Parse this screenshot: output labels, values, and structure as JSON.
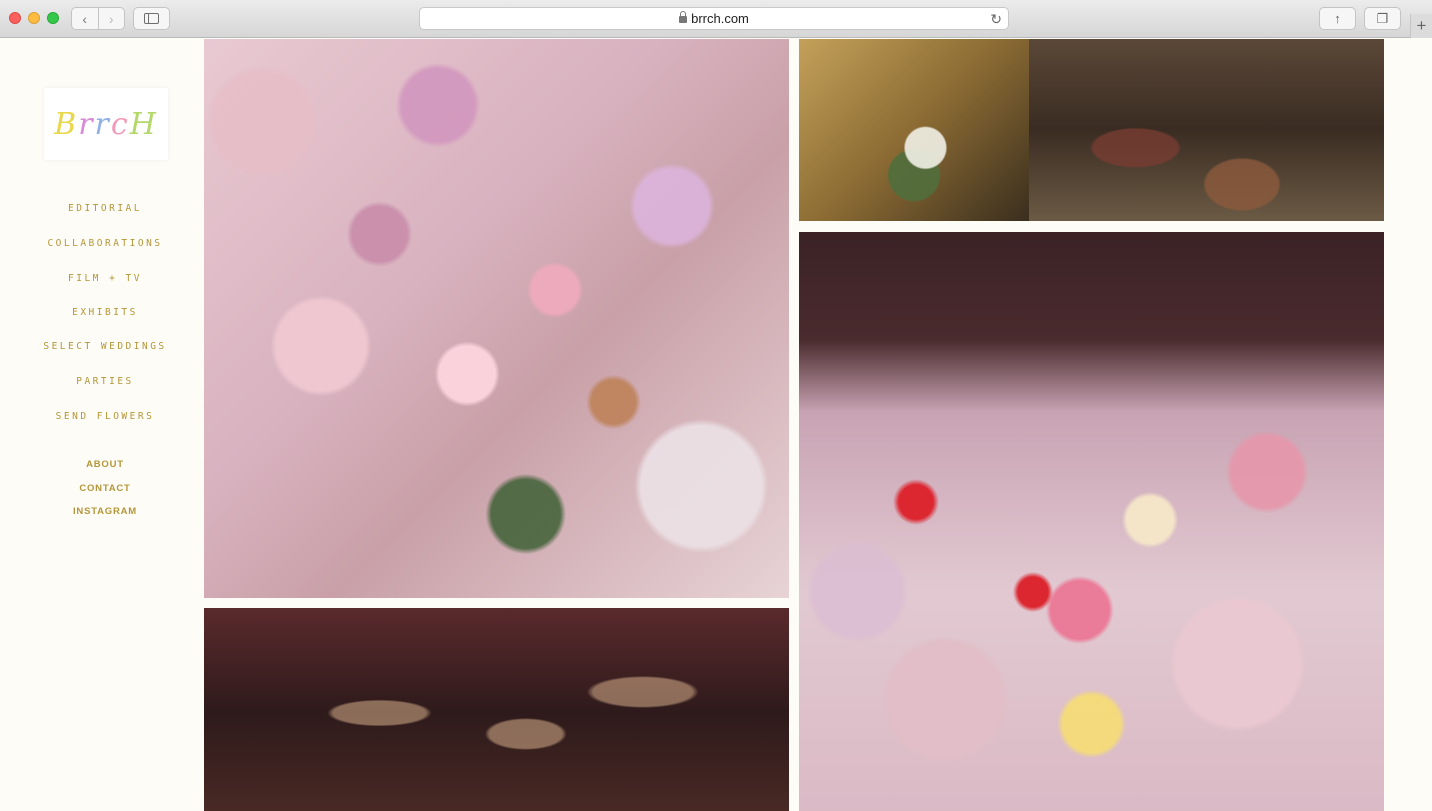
{
  "browser": {
    "url": "brrch.com"
  },
  "site": {
    "logo_text": [
      "B",
      "r",
      "r",
      "c",
      "H"
    ],
    "logo_alt": "BRRCH",
    "nav": {
      "primary": [
        "EDITORIAL",
        "COLLABORATIONS",
        "FILM + TV",
        "EXHIBITS",
        "SELECT WEDDINGS",
        "PARTIES",
        "SEND FLOWERS"
      ],
      "secondary": [
        "ABOUT",
        "CONTACT",
        "INSTAGRAM"
      ]
    }
  },
  "colors": {
    "nav_text": "#b59638",
    "page_bg": "#fdfcf7"
  },
  "gallery": [
    {
      "name": "tablescape-photo"
    },
    {
      "name": "banquet-hall-photo"
    },
    {
      "name": "bouquet-photo"
    },
    {
      "name": "lounge-photo"
    },
    {
      "name": "florals-photo"
    }
  ]
}
